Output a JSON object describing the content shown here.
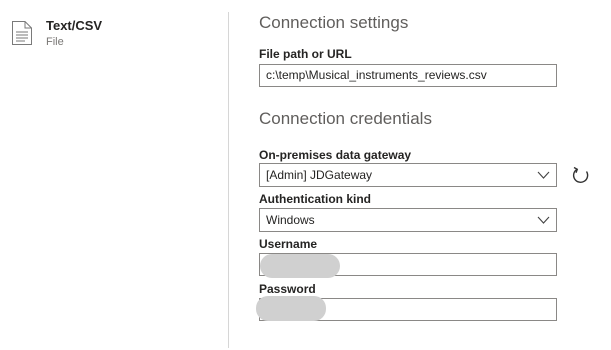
{
  "source": {
    "title": "Text/CSV",
    "subtitle": "File",
    "icon": "file-icon"
  },
  "connection_settings": {
    "heading": "Connection settings",
    "file_path_label": "File path or URL",
    "file_path_value": "c:\\temp\\Musical_instruments_reviews.csv"
  },
  "connection_credentials": {
    "heading": "Connection credentials",
    "gateway_label": "On-premises data gateway",
    "gateway_value": "[Admin] JDGateway",
    "auth_kind_label": "Authentication kind",
    "auth_kind_value": "Windows",
    "username_label": "Username",
    "username_value": "",
    "password_label": "Password",
    "password_value": "",
    "refresh_icon": "refresh-icon"
  },
  "colors": {
    "divider": "#d6d6d6",
    "border": "#8a8886",
    "heading": "#605e5c",
    "redaction": "#d0d0d0"
  }
}
